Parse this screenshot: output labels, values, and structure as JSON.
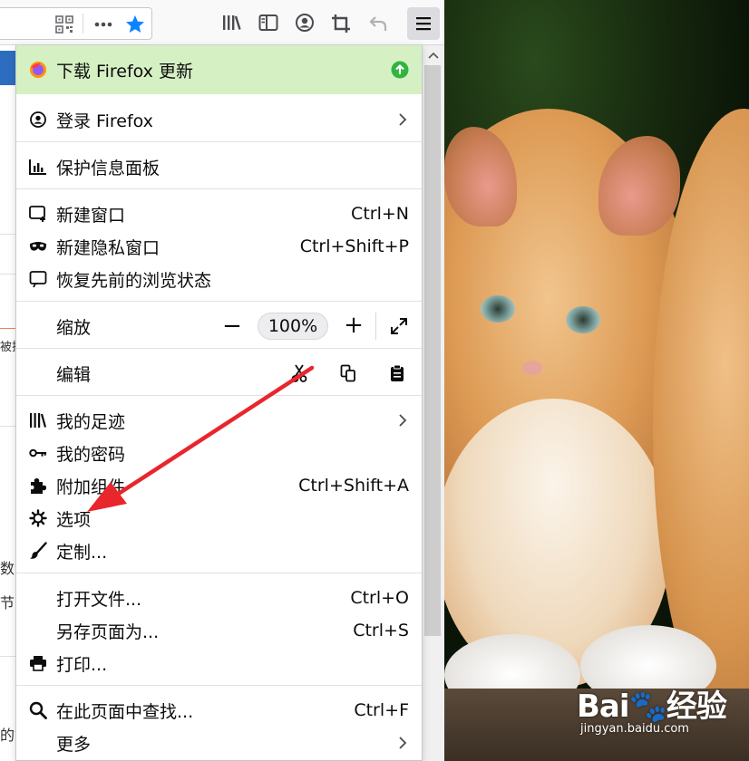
{
  "colors": {
    "banner_bg": "#d5f0c3",
    "update_green": "#30b43e",
    "star_blue": "#0a84ff",
    "arrow_red": "#e8262c"
  },
  "toolbar": {
    "icons": [
      "qr-code-icon",
      "more-dots-icon",
      "bookmark-star-icon",
      "library-icon",
      "sidebar-icon",
      "account-icon",
      "screenshot-icon",
      "back-arrow-icon",
      "hamburger-menu-icon"
    ]
  },
  "page_fragments": {
    "frag1": "被拉",
    "frag2": "数",
    "frag3": "节",
    "frag4": "的如"
  },
  "menu": {
    "update_banner": "下载 Firefox 更新",
    "sign_in": "登录 Firefox",
    "protections": "保护信息面板",
    "new_window": {
      "label": "新建窗口",
      "shortcut": "Ctrl+N"
    },
    "private_window": {
      "label": "新建隐私窗口",
      "shortcut": "Ctrl+Shift+P"
    },
    "restore_session": "恢复先前的浏览状态",
    "zoom": {
      "label": "缩放",
      "minus": "−",
      "value": "100%",
      "plus": "+"
    },
    "edit": {
      "label": "编辑"
    },
    "library": "我的足迹",
    "passwords": "我的密码",
    "addons": {
      "label": "附加组件",
      "shortcut": "Ctrl+Shift+A"
    },
    "options": "选项",
    "customize": "定制...",
    "open_file": {
      "label": "打开文件...",
      "shortcut": "Ctrl+O"
    },
    "save_page": {
      "label": "另存页面为...",
      "shortcut": "Ctrl+S"
    },
    "print": "打印...",
    "find": {
      "label": "在此页面中查找...",
      "shortcut": "Ctrl+F"
    },
    "more": "更多"
  },
  "watermark": {
    "logo": "Bai🐾经验",
    "url": "jingyan.baidu.com"
  }
}
